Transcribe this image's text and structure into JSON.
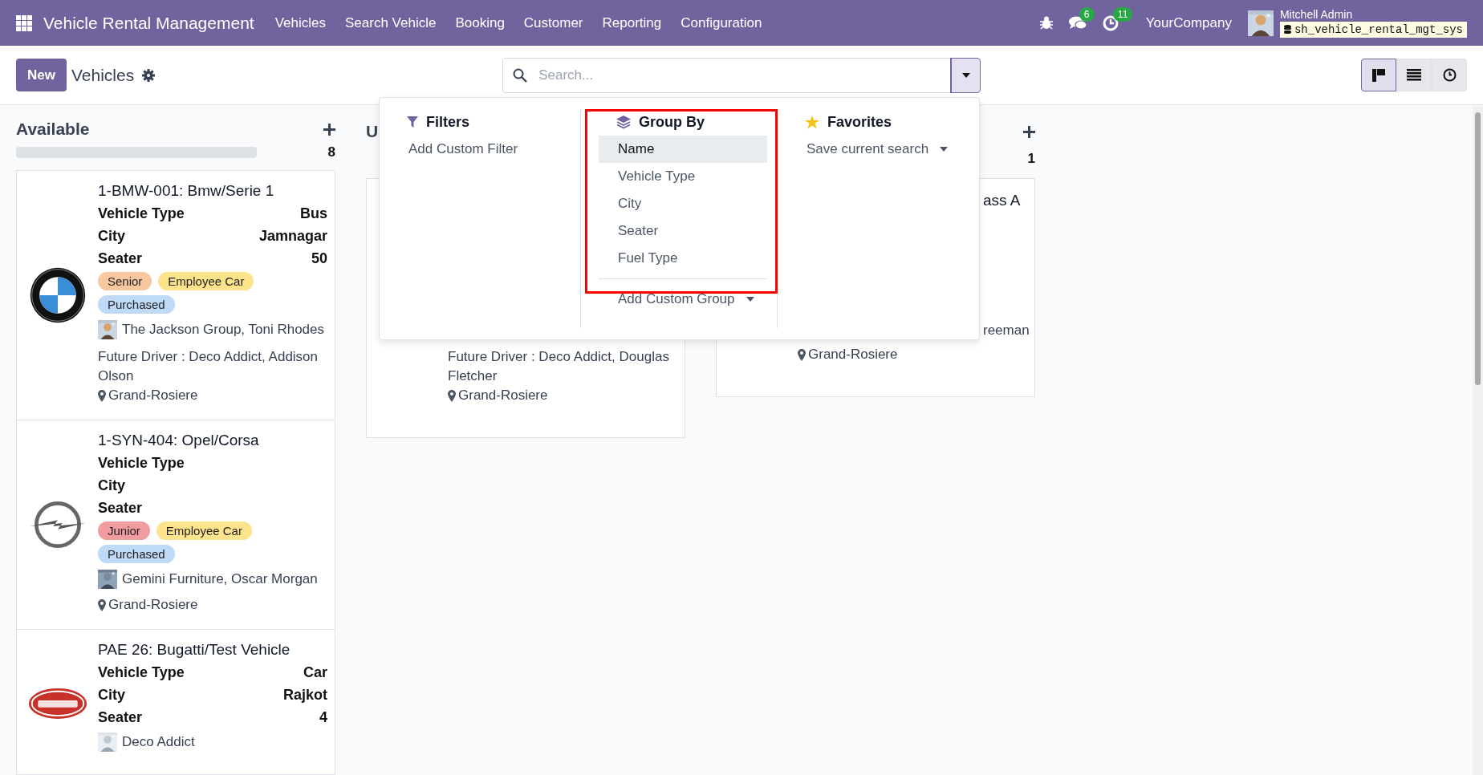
{
  "app": {
    "title": "Vehicle Rental Management",
    "menu": [
      "Vehicles",
      "Search Vehicle",
      "Booking",
      "Customer",
      "Reporting",
      "Configuration"
    ]
  },
  "systray": {
    "messages_count": "6",
    "activities_count": "11",
    "company": "YourCompany",
    "user": "Mitchell Admin",
    "database": "sh_vehicle_rental_mgt_sys"
  },
  "control_panel": {
    "new_button": "New",
    "breadcrumb": "Vehicles",
    "search": {
      "placeholder": "Search..."
    },
    "views": [
      {
        "kind": "kanban",
        "selected": true
      },
      {
        "kind": "list",
        "selected": false
      },
      {
        "kind": "activity",
        "selected": false
      }
    ]
  },
  "search_panel": {
    "filters": {
      "title": "Filters",
      "items": [
        "Add Custom Filter"
      ]
    },
    "group_by": {
      "title": "Group By",
      "options": [
        {
          "label": "Name",
          "selected": true
        },
        {
          "label": "Vehicle Type",
          "selected": false
        },
        {
          "label": "City",
          "selected": false
        },
        {
          "label": "Seater",
          "selected": false
        },
        {
          "label": "Fuel Type",
          "selected": false
        }
      ],
      "custom": "Add Custom Group"
    },
    "favorites": {
      "title": "Favorites",
      "items": [
        "Save current search"
      ]
    }
  },
  "kanban": {
    "columns": [
      {
        "title": "Available",
        "count": "8",
        "progress": {
          "level": 1
        },
        "cards": [
          {
            "title": "1-BMW-001: Bmw/Serie 1",
            "fields": [
              {
                "label": "Vehicle Type",
                "value": "Bus"
              },
              {
                "label": "City",
                "value": "Jamnagar"
              },
              {
                "label": "Seater",
                "value": "50"
              }
            ],
            "tags": [
              {
                "label": "Senior",
                "color": "#f7c8a0"
              },
              {
                "label": "Employee Car",
                "color": "#fde38c"
              },
              {
                "label": "Purchased",
                "color": "#bfdaf7"
              }
            ],
            "partner": "The Jackson Group, Toni Rhodes",
            "future_driver": "Future Driver : Deco Addict, Addison Olson",
            "location": "Grand-Rosiere"
          },
          {
            "title": "1-SYN-404: Opel/Corsa",
            "fields": [
              {
                "label": "Vehicle Type"
              },
              {
                "label": "City"
              },
              {
                "label": "Seater"
              }
            ],
            "tags": [
              {
                "label": "Junior",
                "color": "#f09ca0"
              },
              {
                "label": "Employee Car",
                "color": "#fde38c"
              },
              {
                "label": "Purchased",
                "color": "#bfdaf7"
              }
            ],
            "partner": "Gemini Furniture, Oscar Morgan",
            "location": "Grand-Rosiere"
          },
          {
            "title": "PAE 26: Bugatti/Test Vehicle",
            "fields": [
              {
                "label": "Vehicle Type",
                "value": "Car"
              },
              {
                "label": "City",
                "value": "Rajkot"
              },
              {
                "label": "Seater",
                "value": "4"
              }
            ],
            "partner": "Deco Addict"
          }
        ]
      },
      {
        "title": "U",
        "cards": [
          {
            "future_driver": "Future Driver : Deco Addict, Douglas Fletcher",
            "location": "Grand-Rosiere"
          }
        ]
      },
      {
        "count": "1",
        "cards": [
          {
            "title": "ass A",
            "partner": "reeman",
            "location": "Grand-Rosiere"
          }
        ]
      }
    ]
  }
}
